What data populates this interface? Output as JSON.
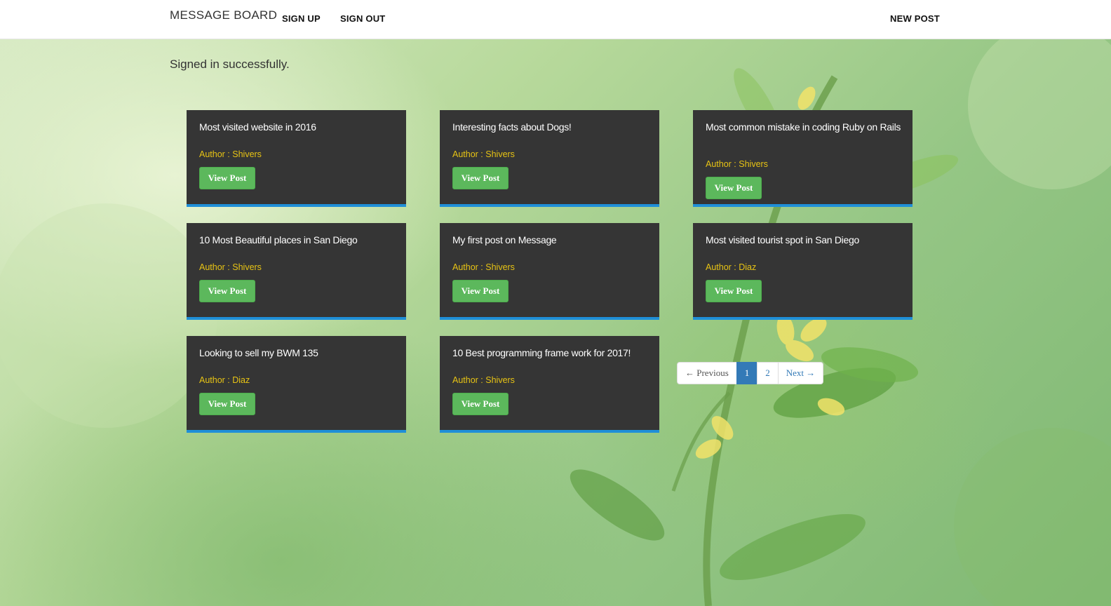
{
  "nav": {
    "brand": "MESSAGE BOARD",
    "sign_up": "SIGN UP",
    "sign_out": "SIGN OUT",
    "new_post": "NEW POST"
  },
  "flash": "Signed in successfully.",
  "posts": [
    {
      "title": "Most visited website in 2016",
      "author": "Author : Shivers",
      "button": "View Post"
    },
    {
      "title": "Interesting facts about Dogs!",
      "author": "Author : Shivers",
      "button": "View Post"
    },
    {
      "title": "Most common mistake in coding Ruby on Rails",
      "author": "Author : Shivers",
      "button": "View Post"
    },
    {
      "title": "10 Most Beautiful places in San Diego",
      "author": "Author : Shivers",
      "button": "View Post"
    },
    {
      "title": "My first post on Message",
      "author": "Author : Shivers",
      "button": "View Post"
    },
    {
      "title": "Most visited tourist spot in San Diego",
      "author": "Author : Diaz",
      "button": "View Post"
    },
    {
      "title": "Looking to sell my BWM 135",
      "author": "Author : Diaz",
      "button": "View Post"
    },
    {
      "title": "10 Best programming frame work for 2017!",
      "author": "Author : Shivers",
      "button": "View Post"
    }
  ],
  "pagination": {
    "previous": "← Previous",
    "pages": [
      "1",
      "2"
    ],
    "current": "1",
    "next": "Next →"
  },
  "colors": {
    "card_bg": "#353535",
    "card_border": "#1f8fd8",
    "author": "#e8c414",
    "button": "#5cb85c",
    "pagination_active": "#337ab7"
  }
}
